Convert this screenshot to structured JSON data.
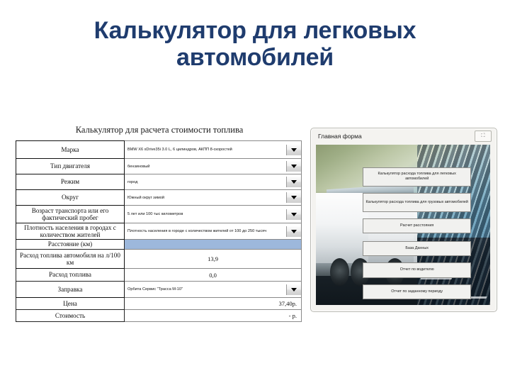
{
  "slide": {
    "title": "Калькулятор для легковых автомобилей",
    "title_color": "#1F3C6E"
  },
  "calculator": {
    "subtitle": "Калькулятор для расчета стоимости топлива",
    "highlight_color": "#9DB8DC",
    "rows": [
      {
        "label": "Марка",
        "value": "BMW X6 xDrive35i 3.0 L, 6 цилиндров, АКПП 8-скоростей",
        "control": "dropdown"
      },
      {
        "label": "Тип двигателя",
        "value": "бензиновый",
        "control": "dropdown"
      },
      {
        "label": "Режим",
        "value": "город",
        "control": "dropdown"
      },
      {
        "label": "Округ",
        "value": "Южный округ зимой",
        "control": "dropdown"
      },
      {
        "label": "Возраст транспорта или его фактический пробег",
        "value": "5 лет или 100 тыс километров",
        "control": "dropdown"
      },
      {
        "label": "Плотность населения в городах с количеством жителей",
        "value": "Плотность населения в городе с количеством жителей от 100 до 250 тысяч",
        "control": "dropdown"
      },
      {
        "label": "Расстояние (км)",
        "value": "",
        "control": "input-highlight"
      },
      {
        "label": "Расход топлива автомобиля на л/100 км",
        "value": "13,9",
        "control": "readonly-center"
      },
      {
        "label": "Расход топлива",
        "value": "0,0",
        "control": "readonly-center"
      },
      {
        "label": "Заправка",
        "value": "Орбита Сервис \"Трасса М-10\"",
        "control": "dropdown"
      },
      {
        "label": "Цена",
        "value": "37,40р.",
        "control": "readonly-right"
      },
      {
        "label": "Стоимость",
        "value": "-   р.",
        "control": "readonly-right"
      }
    ]
  },
  "main_form": {
    "title": "Главная форма",
    "window_button": "⛶",
    "buttons": [
      "Калькулятор расхода топлива для легковых автомобилей",
      "Калькулятор расхода топлива для грузовых автомобилей",
      "Расчет расстояния",
      "База Данных",
      "Отчет по водителю",
      "Отчет по заданному периоду"
    ]
  }
}
